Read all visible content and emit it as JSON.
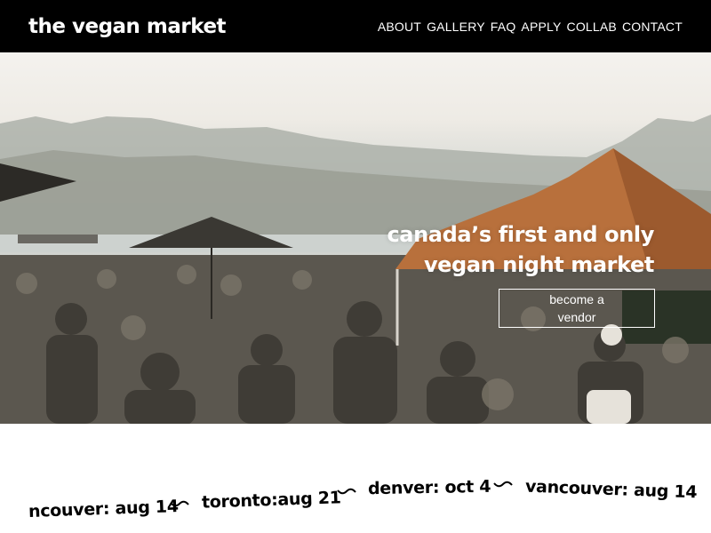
{
  "header": {
    "logo": "the vegan market",
    "nav": {
      "about": "ABOUT",
      "gallery": "GALLERY",
      "faq": "FAQ",
      "apply": "APPLY",
      "collab": "COLLAB",
      "contact": "CONTACT"
    }
  },
  "hero": {
    "heading_line1": "canada’s first and only",
    "heading_line2": "vegan night market",
    "cta_button": "become a vendor"
  },
  "ticker": {
    "item1": "ncouver: aug 14",
    "item2": "toronto:aug 21",
    "item3": "denver: oct 4",
    "item4": "vancouver: aug 14"
  },
  "colors": {
    "header_bg": "#000000",
    "text_light": "#ffffff",
    "text_dark": "#000000",
    "tent": "#b8703c"
  }
}
